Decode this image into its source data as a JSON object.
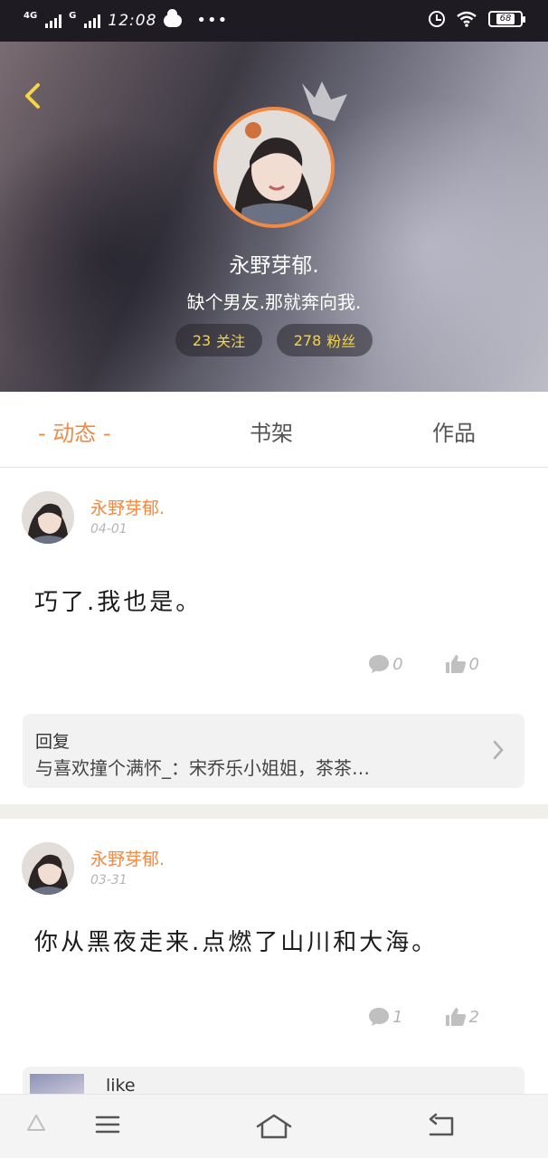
{
  "status_bar": {
    "network_1": "4G",
    "network_2": "G",
    "time": "12:08",
    "battery": "68"
  },
  "profile": {
    "name": "永野芽郁.",
    "bio": "缺个男友.那就奔向我.",
    "following_count": "23",
    "following_label": "关注",
    "fans_count": "278",
    "fans_label": "粉丝"
  },
  "tabs": [
    {
      "label": "- 动态 -",
      "active": true
    },
    {
      "label": "书架",
      "active": false
    },
    {
      "label": "作品",
      "active": false
    }
  ],
  "posts": [
    {
      "author": "永野芽郁.",
      "date": "04-01",
      "text": "巧了.我也是。",
      "comments": "0",
      "likes": "0",
      "reply_label": "回复",
      "reply_text": "与喜欢撞个满怀_：宋乔乐小姐姐，茶茶…"
    },
    {
      "author": "永野芽郁.",
      "date": "03-31",
      "text": "你从黑夜走来.点燃了山川和大海。",
      "comments": "1",
      "likes": "2",
      "reply_peek": "like"
    }
  ],
  "colors": {
    "accent": "#f08a44",
    "pill_text": "#f5d542"
  },
  "icons": [
    "back-chevron-icon",
    "crown-icon",
    "comment-icon",
    "thumbs-up-icon",
    "chevron-right-icon",
    "menu-icon",
    "home-icon",
    "back-nav-icon"
  ]
}
